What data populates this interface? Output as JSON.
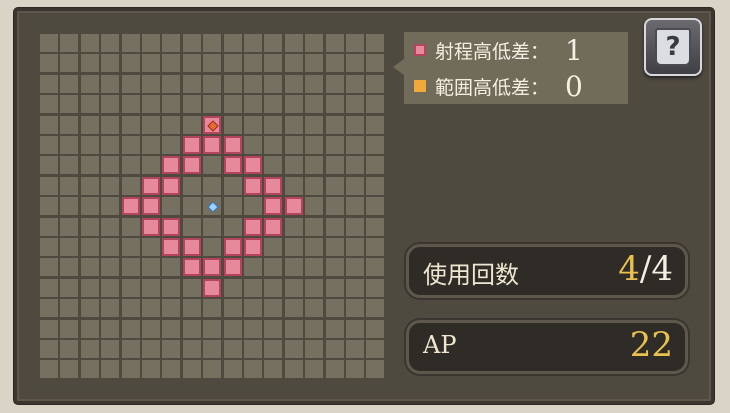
{
  "grid": {
    "cols": 17,
    "rows": 17,
    "caster": [
      8,
      8
    ],
    "target": [
      8,
      4
    ],
    "range_cells": [
      [
        8,
        4
      ],
      [
        7,
        5
      ],
      [
        8,
        5
      ],
      [
        9,
        5
      ],
      [
        6,
        6
      ],
      [
        7,
        6
      ],
      [
        9,
        6
      ],
      [
        10,
        6
      ],
      [
        5,
        7
      ],
      [
        6,
        7
      ],
      [
        10,
        7
      ],
      [
        11,
        7
      ],
      [
        4,
        8
      ],
      [
        5,
        8
      ],
      [
        11,
        8
      ],
      [
        12,
        8
      ],
      [
        5,
        9
      ],
      [
        6,
        9
      ],
      [
        10,
        9
      ],
      [
        11,
        9
      ],
      [
        6,
        10
      ],
      [
        7,
        10
      ],
      [
        9,
        10
      ],
      [
        10,
        10
      ],
      [
        7,
        11
      ],
      [
        8,
        11
      ],
      [
        9,
        11
      ],
      [
        8,
        12
      ]
    ]
  },
  "legend": {
    "range_height_label": "射程高低差：",
    "range_height_value": "1",
    "area_height_label": "範囲高低差：",
    "area_height_value": "0",
    "range_color": "#e68a9b",
    "area_color": "#f0a93a"
  },
  "help": {
    "symbol": "?",
    "icon": "help-book-icon"
  },
  "uses": {
    "label": "使用回数",
    "current": "4",
    "slash": "/",
    "max": "4"
  },
  "ap": {
    "label": "AP",
    "value": "22"
  }
}
